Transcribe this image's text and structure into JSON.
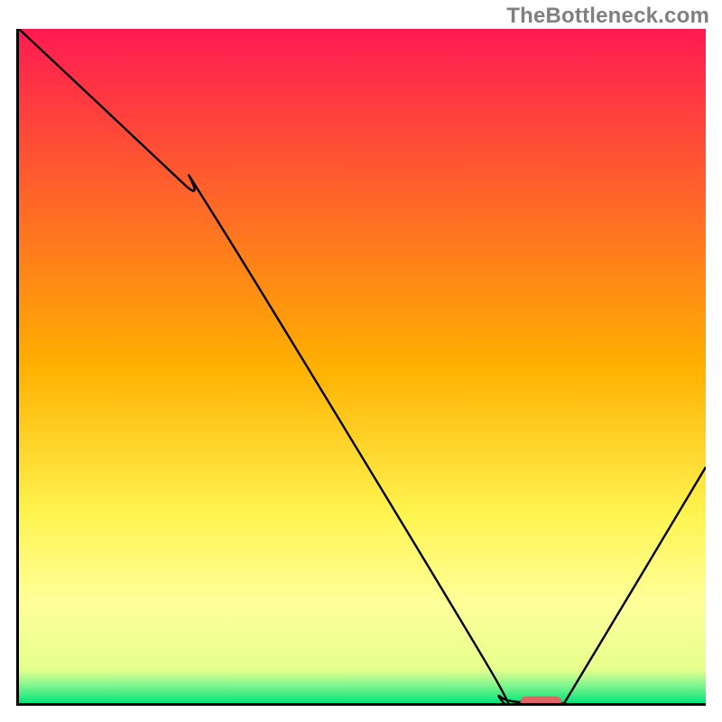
{
  "watermark": "TheBottleneck.com",
  "chart_data": {
    "type": "line",
    "title": "",
    "xlabel": "",
    "ylabel": "",
    "xlim": [
      0,
      100
    ],
    "ylim": [
      0,
      100
    ],
    "background": {
      "type": "vertical-gradient",
      "stops": [
        {
          "offset": 0.0,
          "color": "#ff1a52"
        },
        {
          "offset": 0.5,
          "color": "#ffb000"
        },
        {
          "offset": 0.72,
          "color": "#fff450"
        },
        {
          "offset": 0.85,
          "color": "#ffff9a"
        },
        {
          "offset": 0.95,
          "color": "#e6ff8c"
        },
        {
          "offset": 0.975,
          "color": "#7cf590"
        },
        {
          "offset": 1.0,
          "color": "#00e57a"
        }
      ]
    },
    "series": [
      {
        "name": "curve",
        "type": "line",
        "color": "#000000",
        "x": [
          0,
          24,
          28,
          68,
          70,
          75,
          79,
          80,
          100
        ],
        "values": [
          100,
          77,
          73,
          6,
          1,
          0,
          0,
          1,
          35
        ]
      }
    ],
    "marker": {
      "shape": "rounded-rect",
      "color": "#e06666",
      "x": 76,
      "y": 0,
      "width": 6,
      "height": 2
    },
    "axes": {
      "color": "#000000",
      "width": 3,
      "xticks": [],
      "yticks": []
    }
  }
}
